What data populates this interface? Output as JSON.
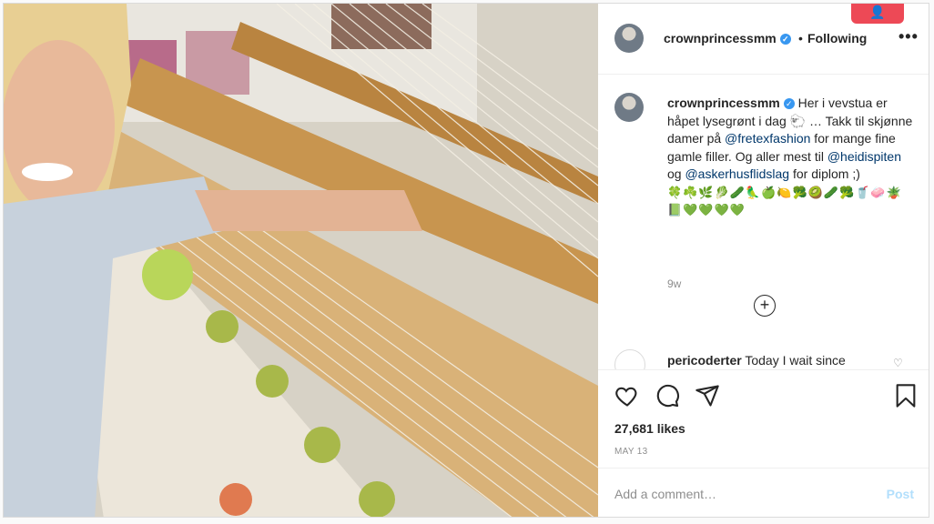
{
  "post": {
    "username": "crownprincessmm",
    "follow_status": "Following",
    "separator": "•",
    "more_label": "•••",
    "caption": {
      "username": "crownprincessmm",
      "text_before": "Her i vevstua er håpet lysegrønt i dag 🐑 … Takk til skjønne damer på ",
      "mention1": "@fretexfashion",
      "text_mid1": " for mange fine gamle filler. Og aller mest til ",
      "mention2": "@heidispiten",
      "text_mid2": " og ",
      "mention3": "@askerhusflidslag",
      "text_after": " for diplom ;)",
      "emojis": "🍀☘️🌿🥬🥒🦜🍏🍋🥦🥝🥒🥦🥤🧼🪴📗💚💚💚💚",
      "age": "9w"
    },
    "load_more": "+",
    "comment": {
      "username": "pericoderter",
      "text": "Today I wait since"
    },
    "likes": "27,681 likes",
    "date": "MAY 13",
    "add_comment_placeholder": "Add a comment…",
    "post_button": "Post"
  },
  "icons": {
    "like": "heart-icon",
    "comment": "comment-icon",
    "share": "share-icon",
    "save": "bookmark-icon",
    "verified": "verified-badge-icon"
  },
  "colors": {
    "link": "#00376b",
    "verified": "#3897f0",
    "post_disabled": "#b2dffc",
    "notification_red": "#ed4956"
  }
}
